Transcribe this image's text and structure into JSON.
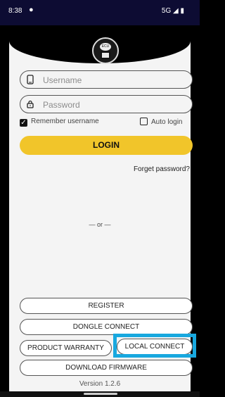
{
  "status": {
    "time": "8:38",
    "network": "5G"
  },
  "logo": {
    "text": "ECU"
  },
  "form": {
    "username_placeholder": "Username",
    "password_placeholder": "Password",
    "remember_label": "Remember username",
    "auto_login_label": "Auto login",
    "login_label": "LOGIN",
    "forget_label": "Forget password?"
  },
  "divider": {
    "or_text": "— or —"
  },
  "actions": {
    "register": "REGISTER",
    "dongle_connect": "DONGLE CONNECT",
    "product_warranty": "PRODUCT WARRANTY",
    "local_connect": "LOCAL CONNECT",
    "download_firmware": "DOWNLOAD FIRMWARE"
  },
  "footer": {
    "version": "Version 1.2.6"
  },
  "colors": {
    "accent": "#f1c52a",
    "highlight": "#18a8df"
  }
}
